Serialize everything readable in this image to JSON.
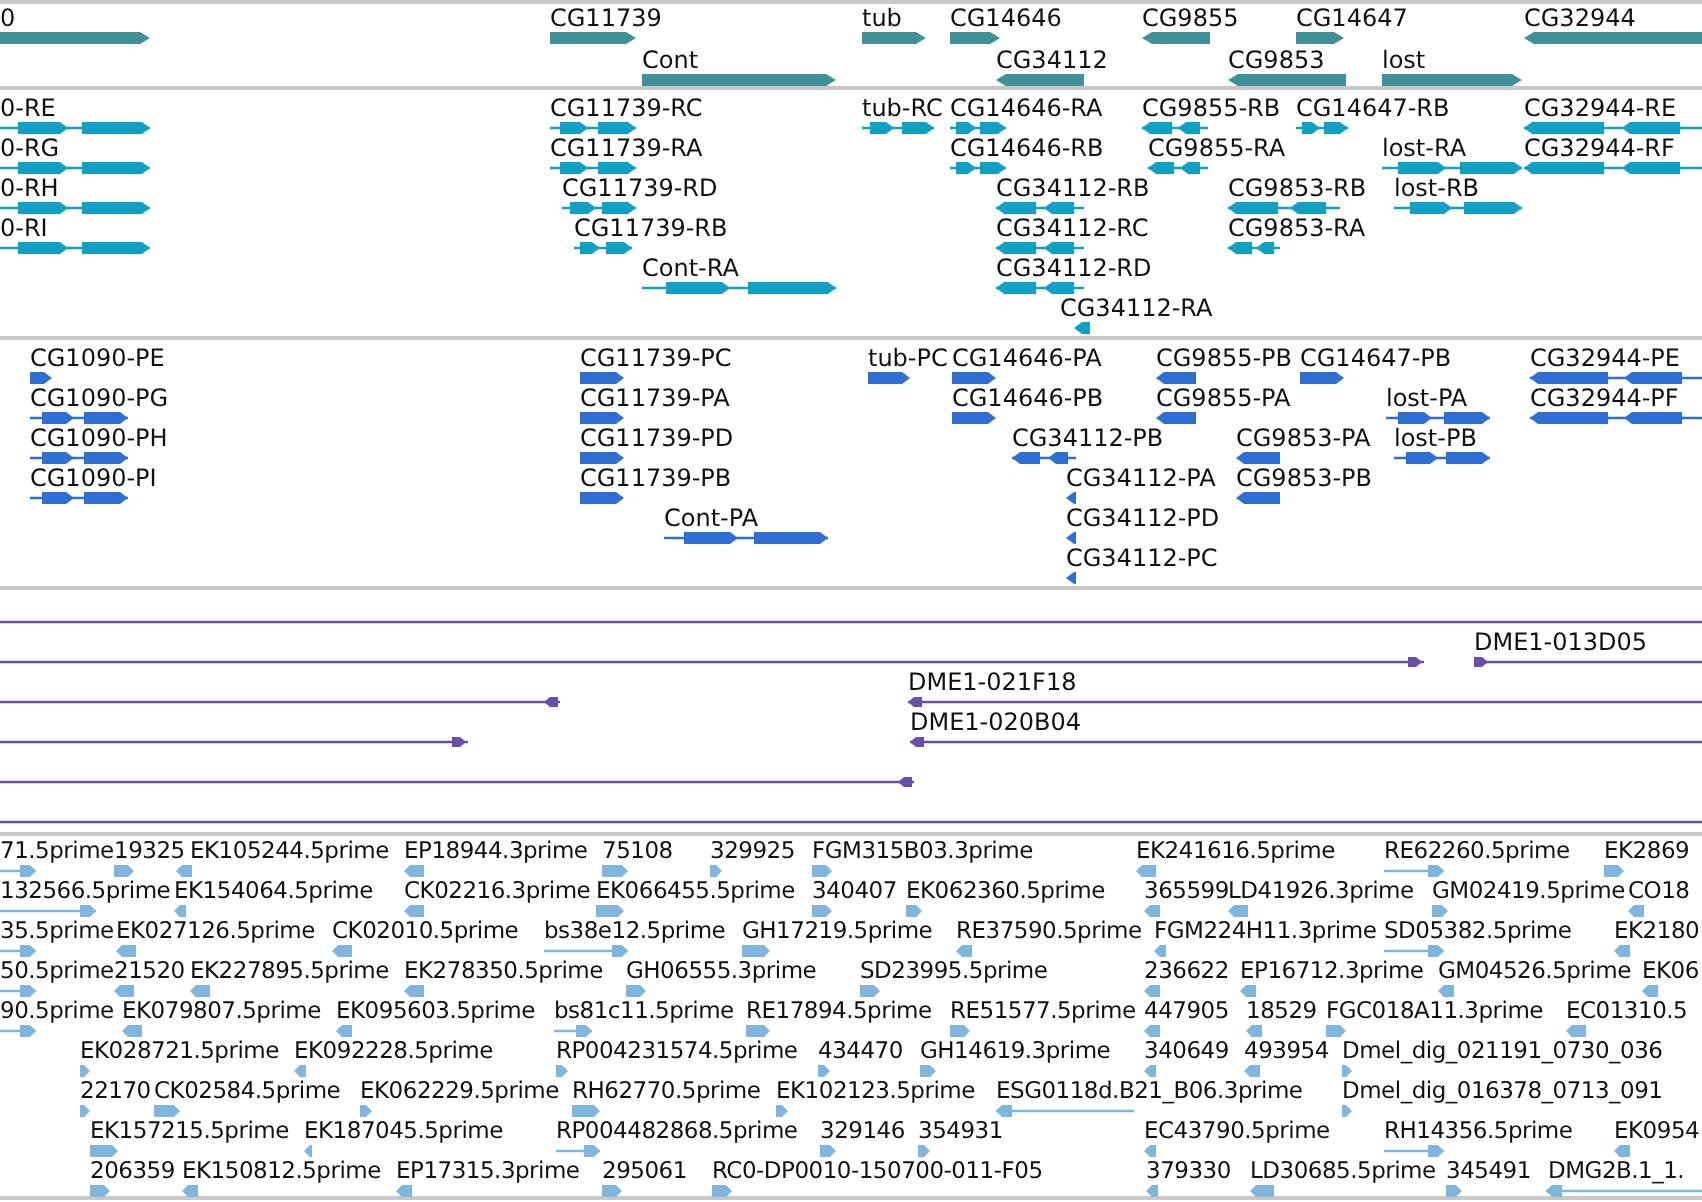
{
  "tracks": [
    {
      "kind": "gene",
      "features": [
        {
          "label": "0",
          "reverse": false
        },
        {
          "label": "CG11739",
          "reverse": false
        },
        {
          "label": "Cont",
          "reverse": false
        },
        {
          "label": "tub",
          "reverse": false
        },
        {
          "label": "CG14646",
          "reverse": false
        },
        {
          "label": "CG34112",
          "reverse": true
        },
        {
          "label": "CG9855",
          "reverse": true
        },
        {
          "label": "CG9853",
          "reverse": true
        },
        {
          "label": "CG14647",
          "reverse": false
        },
        {
          "label": "lost",
          "reverse": false
        },
        {
          "label": "CG32944",
          "reverse": true
        }
      ]
    },
    {
      "kind": "transcript",
      "features": [
        {
          "label": "0-RE",
          "reverse": false
        },
        {
          "label": "0-RG",
          "reverse": false
        },
        {
          "label": "0-RH",
          "reverse": false
        },
        {
          "label": "0-RI",
          "reverse": false
        },
        {
          "label": "CG11739-RC",
          "reverse": false
        },
        {
          "label": "CG11739-RA",
          "reverse": false
        },
        {
          "label": "CG11739-RD",
          "reverse": false
        },
        {
          "label": "CG11739-RB",
          "reverse": false
        },
        {
          "label": "Cont-RA",
          "reverse": false
        },
        {
          "label": "tub-RC",
          "reverse": false
        },
        {
          "label": "CG14646-RA",
          "reverse": false
        },
        {
          "label": "CG14646-RB",
          "reverse": false
        },
        {
          "label": "CG34112-RB",
          "reverse": true
        },
        {
          "label": "CG34112-RC",
          "reverse": true
        },
        {
          "label": "CG34112-RD",
          "reverse": true
        },
        {
          "label": "CG34112-RA",
          "reverse": true
        },
        {
          "label": "CG9855-RB",
          "reverse": true
        },
        {
          "label": "CG9855-RA",
          "reverse": true
        },
        {
          "label": "CG14647-RB",
          "reverse": false
        },
        {
          "label": "CG9853-RB",
          "reverse": true
        },
        {
          "label": "CG9853-RA",
          "reverse": true
        },
        {
          "label": "lost-RA",
          "reverse": false
        },
        {
          "label": "lost-RB",
          "reverse": false
        },
        {
          "label": "CG32944-RE",
          "reverse": true
        },
        {
          "label": "CG32944-RF",
          "reverse": true
        }
      ]
    },
    {
      "kind": "protein",
      "features": [
        {
          "label": "CG1090-PE",
          "reverse": false
        },
        {
          "label": "CG1090-PG",
          "reverse": false
        },
        {
          "label": "CG1090-PH",
          "reverse": false
        },
        {
          "label": "CG1090-PI",
          "reverse": false
        },
        {
          "label": "CG11739-PC",
          "reverse": false
        },
        {
          "label": "CG11739-PA",
          "reverse": false
        },
        {
          "label": "CG11739-PD",
          "reverse": false
        },
        {
          "label": "CG11739-PB",
          "reverse": false
        },
        {
          "label": "Cont-PA",
          "reverse": false
        },
        {
          "label": "tub-PC",
          "reverse": false
        },
        {
          "label": "CG14646-PA",
          "reverse": false
        },
        {
          "label": "CG14646-PB",
          "reverse": false
        },
        {
          "label": "CG34112-PB",
          "reverse": true
        },
        {
          "label": "CG34112-PA",
          "reverse": true
        },
        {
          "label": "CG34112-PD",
          "reverse": true
        },
        {
          "label": "CG34112-PC",
          "reverse": true
        },
        {
          "label": "CG9855-PB",
          "reverse": true
        },
        {
          "label": "CG9855-PA",
          "reverse": true
        },
        {
          "label": "CG14647-PB",
          "reverse": false
        },
        {
          "label": "CG9853-PA",
          "reverse": true
        },
        {
          "label": "CG9853-PB",
          "reverse": true
        },
        {
          "label": "lost-PA",
          "reverse": false
        },
        {
          "label": "lost-PB",
          "reverse": false
        },
        {
          "label": "CG32944-PE",
          "reverse": true
        },
        {
          "label": "CG32944-PF",
          "reverse": true
        }
      ]
    },
    {
      "kind": "clone",
      "features": [
        {
          "arrow": false
        },
        {
          "arrow": true,
          "reverse": false
        },
        {
          "label": "DME1-013D05",
          "arrow": true,
          "reverse": false
        },
        {
          "arrow": true,
          "reverse": true
        },
        {
          "label": "DME1-021F18",
          "arrow": true,
          "reverse": true
        },
        {
          "arrow": true,
          "reverse": false
        },
        {
          "label": "DME1-020B04",
          "arrow": true,
          "reverse": true
        },
        {
          "arrow": true,
          "reverse": true
        },
        {
          "arrow": false
        }
      ]
    },
    {
      "kind": "est",
      "features": [
        {
          "label": "71.5prime",
          "reverse": false
        },
        {
          "label": "19325",
          "reverse": false
        },
        {
          "label": "EK105244.5prime",
          "reverse": true
        },
        {
          "label": "EP18944.3prime",
          "reverse": true
        },
        {
          "label": "75108",
          "reverse": false
        },
        {
          "label": "329925",
          "reverse": false
        },
        {
          "label": "FGM315B03.3prime",
          "reverse": false
        },
        {
          "label": "EK241616.5prime",
          "reverse": true
        },
        {
          "label": "RE62260.5prime",
          "reverse": false
        },
        {
          "label": "EK2869",
          "reverse": false
        },
        {
          "label": "132566.5prime",
          "reverse": false
        },
        {
          "label": "EK154064.5prime",
          "reverse": true
        },
        {
          "label": "CK02216.3prime",
          "reverse": true
        },
        {
          "label": "EK066455.5prime",
          "reverse": false
        },
        {
          "label": "340407",
          "reverse": false
        },
        {
          "label": "EK062360.5prime",
          "reverse": false
        },
        {
          "label": "365599",
          "reverse": true
        },
        {
          "label": "LD41926.3prime",
          "reverse": true
        },
        {
          "label": "GM02419.5prime",
          "reverse": false
        },
        {
          "label": "CO18",
          "reverse": true
        },
        {
          "label": "35.5prime",
          "reverse": false
        },
        {
          "label": "EK027126.5prime",
          "reverse": true
        },
        {
          "label": "CK02010.5prime",
          "reverse": true
        },
        {
          "label": "bs38e12.5prime",
          "reverse": false
        },
        {
          "label": "GH17219.5prime",
          "reverse": false
        },
        {
          "label": "RE37590.5prime",
          "reverse": true
        },
        {
          "label": "FGM224H11.3prime",
          "reverse": true
        },
        {
          "label": "SD05382.5prime",
          "reverse": false
        },
        {
          "label": "EK2180",
          "reverse": true
        },
        {
          "label": "50.5prime",
          "reverse": false
        },
        {
          "label": "21520",
          "reverse": true
        },
        {
          "label": "EK227895.5prime",
          "reverse": true
        },
        {
          "label": "EK278350.5prime",
          "reverse": true
        },
        {
          "label": "GH06555.3prime",
          "reverse": false
        },
        {
          "label": "SD23995.5prime",
          "reverse": false
        },
        {
          "label": "236622",
          "reverse": true
        },
        {
          "label": "EP16712.3prime",
          "reverse": true
        },
        {
          "label": "GM04526.5prime",
          "reverse": true
        },
        {
          "label": "EK06",
          "reverse": true
        },
        {
          "label": "90.5prime",
          "reverse": false
        },
        {
          "label": "EK079807.5prime",
          "reverse": true
        },
        {
          "label": "EK095603.5prime",
          "reverse": true
        },
        {
          "label": "bs81c11.5prime",
          "reverse": false
        },
        {
          "label": "RE17894.5prime",
          "reverse": false
        },
        {
          "label": "RE51577.5prime",
          "reverse": false
        },
        {
          "label": "447905",
          "reverse": true
        },
        {
          "label": "18529",
          "reverse": true
        },
        {
          "label": "FGC018A11.3prime",
          "reverse": false
        },
        {
          "label": "EC01310.5",
          "reverse": true
        },
        {
          "label": "EK028721.5prime",
          "reverse": false
        },
        {
          "label": "EK092228.5prime",
          "reverse": true
        },
        {
          "label": "RP004231574.5prime",
          "reverse": false
        },
        {
          "label": "434470",
          "reverse": false
        },
        {
          "label": "GH14619.3prime",
          "reverse": false
        },
        {
          "label": "340649",
          "reverse": true
        },
        {
          "label": "493954",
          "reverse": true
        },
        {
          "label": "Dmel_dig_021191_0730_036",
          "reverse": false
        },
        {
          "label": "22170",
          "reverse": false
        },
        {
          "label": "CK02584.5prime",
          "reverse": false
        },
        {
          "label": "EK062229.5prime",
          "reverse": false
        },
        {
          "label": "RH62770.5prime",
          "reverse": false
        },
        {
          "label": "EK102123.5prime",
          "reverse": false
        },
        {
          "label": "ESG0118d.B21_B06.3prime",
          "reverse": true
        },
        {
          "label": "Dmel_dig_016378_0713_091",
          "reverse": false
        },
        {
          "label": "EK157215.5prime",
          "reverse": false
        },
        {
          "label": "EK187045.5prime",
          "reverse": true
        },
        {
          "label": "RP004482868.5prime",
          "reverse": false
        },
        {
          "label": "329146",
          "reverse": false
        },
        {
          "label": "354931",
          "reverse": false
        },
        {
          "label": "EC43790.5prime",
          "reverse": true
        },
        {
          "label": "RH14356.5prime",
          "reverse": false
        },
        {
          "label": "EK0954",
          "reverse": true
        },
        {
          "label": "206359",
          "reverse": false
        },
        {
          "label": "EK150812.5prime",
          "reverse": true
        },
        {
          "label": "EP17315.3prime",
          "reverse": true
        },
        {
          "label": "295061",
          "reverse": false
        },
        {
          "label": "RC0-DP0010-150700-011-F05",
          "reverse": false
        },
        {
          "label": "379330",
          "reverse": true
        },
        {
          "label": "LD30685.5prime",
          "reverse": true
        },
        {
          "label": "345491",
          "reverse": false
        },
        {
          "label": "DMG2B.1_1.",
          "reverse": true
        }
      ]
    }
  ]
}
